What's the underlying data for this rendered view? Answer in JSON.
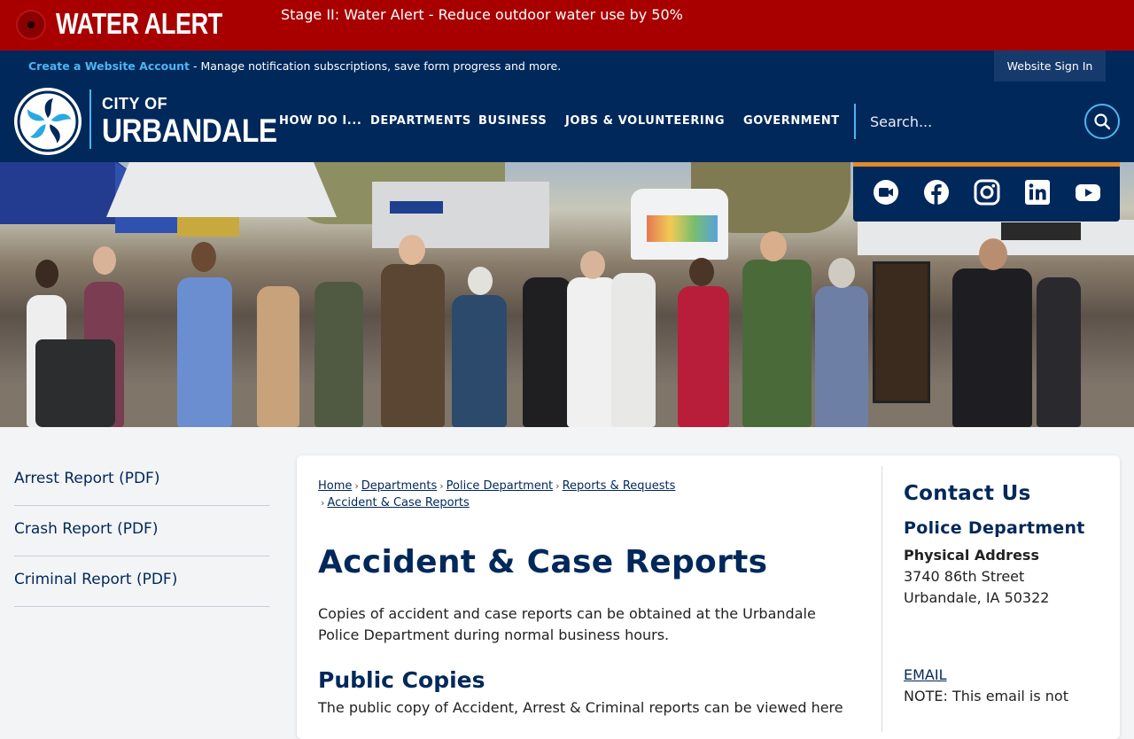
{
  "alert": {
    "title": "WATER ALERT",
    "message": "Stage II: Water Alert - Reduce outdoor water use by 50%"
  },
  "account_bar": {
    "create_link": "Create a Website Account",
    "description": " - Manage notification subscriptions, save form progress and more.",
    "signin_label": "Website Sign In"
  },
  "header": {
    "logo_small": "CITY OF",
    "logo_large": "URBANDALE",
    "nav": [
      "HOW DO I...",
      "DEPARTMENTS",
      "BUSINESS",
      "JOBS & VOLUNTEERING",
      "GOVERNMENT"
    ],
    "search_placeholder": "Search..."
  },
  "social": {
    "icons": [
      "video-camera-icon",
      "facebook-icon",
      "instagram-icon",
      "linkedin-icon",
      "youtube-icon"
    ],
    "accent_color": "#e28a2b"
  },
  "left_nav": [
    "Arrest Report (PDF)",
    "Crash Report (PDF)",
    "Criminal Report (PDF)"
  ],
  "breadcrumb": [
    "Home",
    "Departments",
    "Police Department",
    "Reports & Requests",
    "Accident & Case Reports"
  ],
  "main": {
    "title": "Accident & Case Reports",
    "intro": "Copies of accident and case reports can be obtained at the Urbandale Police Department during normal business hours.",
    "section_heading": "Public Copies",
    "section_text": "The public copy of Accident, Arrest & Criminal reports can be viewed here"
  },
  "contact": {
    "heading": "Contact Us",
    "department": "Police Department",
    "address_label": "Physical Address",
    "address_line1": "3740 86th Street",
    "address_line2": "Urbandale, IA 50322",
    "email_label": "EMAIL",
    "note": "NOTE: This email is not"
  },
  "colors": {
    "alert_red": "#a80000",
    "navy": "#00285a",
    "accent_blue": "#4fb4f0"
  }
}
